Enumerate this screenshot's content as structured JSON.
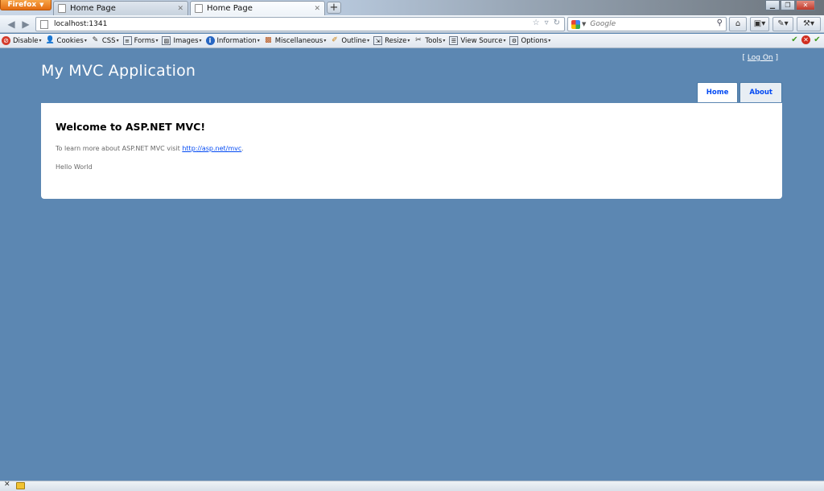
{
  "browser": {
    "app_button": "Firefox",
    "tabs": [
      {
        "label": "Home Page",
        "active": false
      },
      {
        "label": "Home Page",
        "active": true
      }
    ],
    "new_tab": "+",
    "url": "localhost:1341",
    "search_placeholder": "Google",
    "dev_toolbar": [
      {
        "label": "Disable",
        "icon": "no-entry-icon"
      },
      {
        "label": "Cookies",
        "icon": "person-icon"
      },
      {
        "label": "CSS",
        "icon": "pencil-icon"
      },
      {
        "label": "Forms",
        "icon": "form-icon"
      },
      {
        "label": "Images",
        "icon": "image-icon"
      },
      {
        "label": "Information",
        "icon": "info-icon"
      },
      {
        "label": "Miscellaneous",
        "icon": "briefcase-icon"
      },
      {
        "label": "Outline",
        "icon": "marker-icon"
      },
      {
        "label": "Resize",
        "icon": "resize-icon"
      },
      {
        "label": "Tools",
        "icon": "tools-icon"
      },
      {
        "label": "View Source",
        "icon": "document-icon"
      },
      {
        "label": "Options",
        "icon": "options-icon"
      }
    ]
  },
  "site": {
    "login_prefix": "[ ",
    "login_link": "Log On",
    "login_suffix": " ]",
    "title": "My MVC Application",
    "menu": [
      {
        "label": "Home"
      },
      {
        "label": "About"
      }
    ],
    "main": {
      "heading": "Welcome to ASP.NET MVC!",
      "intro_text": "To learn more about ASP.NET MVC visit ",
      "intro_link": "http://asp.net/mvc",
      "intro_end": ".",
      "message": "Hello World"
    }
  },
  "colors": {
    "page_background": "#5c87b2",
    "content_background": "#ffffff",
    "link": "#034af3",
    "firefox_button": "#e46d12"
  }
}
